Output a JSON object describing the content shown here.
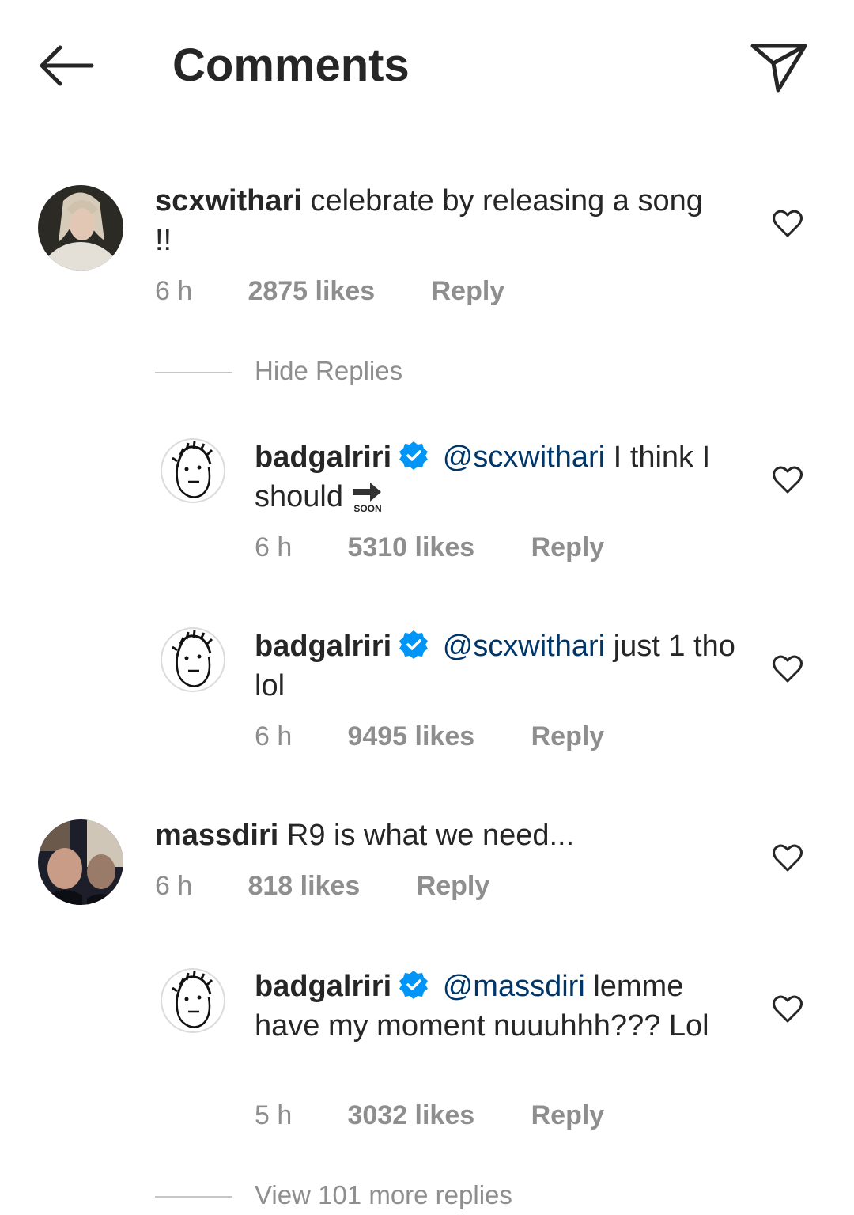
{
  "header": {
    "title": "Comments"
  },
  "comments": [
    {
      "username": "scxwithari",
      "text": "celebrate by releasing a song !!",
      "time": "6 h",
      "likes": "2875 likes",
      "reply_label": "Reply",
      "replies_toggle": "Hide Replies",
      "replies": [
        {
          "username": "badgalriri",
          "mention": "@scxwithari",
          "text": "I think I should",
          "time": "6 h",
          "likes": "5310 likes",
          "reply_label": "Reply",
          "soon_label": "SOON"
        },
        {
          "username": "badgalriri",
          "mention": "@scxwithari",
          "text": "just 1 tho lol",
          "time": "6 h",
          "likes": "9495 likes",
          "reply_label": "Reply"
        }
      ]
    },
    {
      "username": "massdiri",
      "text": "R9 is what we need...",
      "time": "6 h",
      "likes": "818 likes",
      "reply_label": "Reply",
      "replies": [
        {
          "username": "badgalriri",
          "mention": "@massdiri",
          "text": "lemme have my moment nuuuhhh??? Lol",
          "time": "5 h",
          "likes": "3032 likes",
          "reply_label": "Reply"
        }
      ],
      "replies_toggle": "View 101 more replies"
    }
  ]
}
